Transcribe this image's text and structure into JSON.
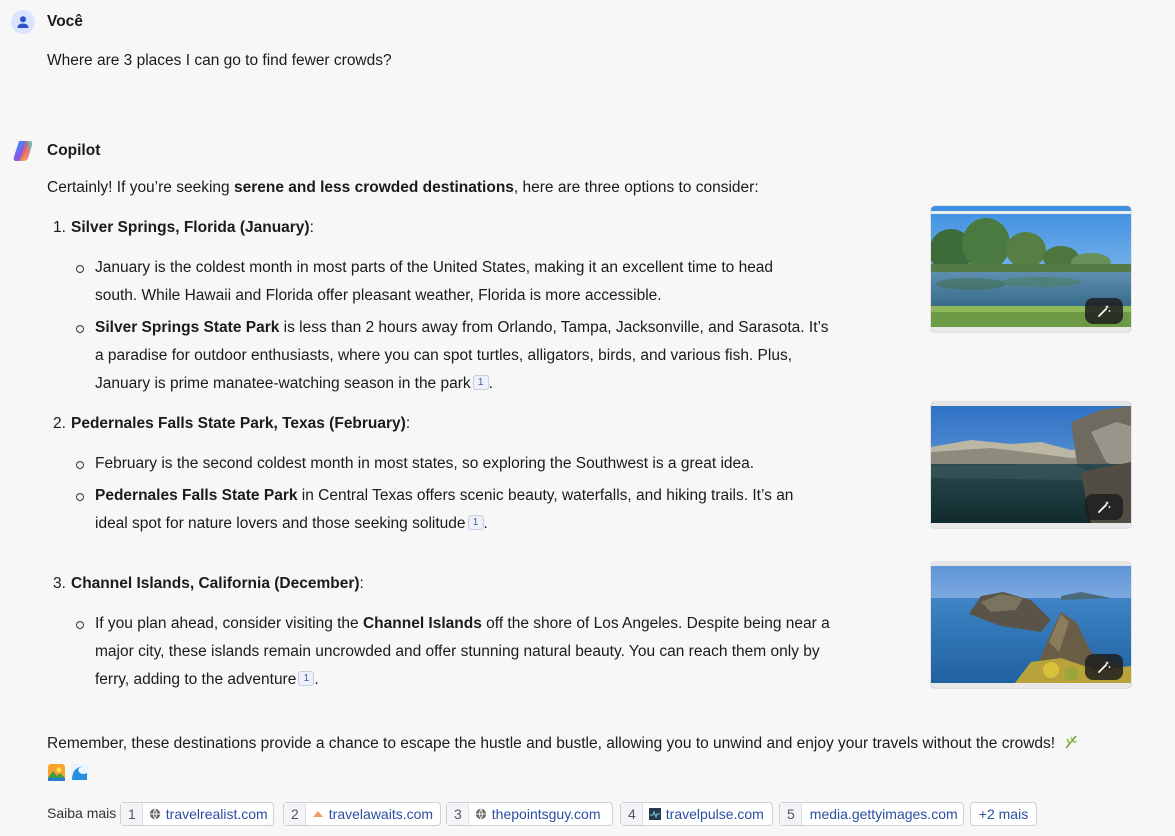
{
  "user": {
    "name": "Você",
    "message": "Where are 3 places I can go to find fewer crowds?"
  },
  "copilot": {
    "name": "Copilot",
    "intro_before": "Certainly! If you’re seeking ",
    "intro_bold": "serene and less crowded destinations",
    "intro_after": ", here are three options to consider:",
    "items": [
      {
        "number": "1.",
        "title": "Silver Springs, Florida (January)",
        "title_suffix": ":",
        "bullets": [
          {
            "pre": "January is the coldest month in most parts of the United States, making it an excellent time to head south. While Hawaii and Florida offer pleasant weather, Florida is more accessible."
          },
          {
            "bold": "Silver Springs State Park",
            "post": " is less than 2 hours away from Orlando, Tampa, Jacksonville, and Sarasota. It’s a paradise for outdoor enthusiasts, where you can spot turtles, alligators, birds, and various fish. Plus, January is prime manatee-watching season in the park",
            "cite": "1",
            "end": "."
          }
        ],
        "image_icon": "magic-wand-icon"
      },
      {
        "number": "2.",
        "title": "Pedernales Falls State Park, Texas (February)",
        "title_suffix": ":",
        "bullets": [
          {
            "pre": "February is the second coldest month in most states, so exploring the Southwest is a great idea."
          },
          {
            "bold": "Pedernales Falls State Park",
            "post": " in Central Texas offers scenic beauty, waterfalls, and hiking trails. It’s an ideal spot for nature lovers and those seeking solitude",
            "cite": "1",
            "end": "."
          }
        ],
        "image_icon": "magic-wand-icon"
      },
      {
        "number": "3.",
        "title": "Channel Islands, California (December)",
        "title_suffix": ":",
        "bullets": [
          {
            "pre": "If you plan ahead, consider visiting the ",
            "bold": "Channel Islands",
            "post": " off the shore of Los Angeles. Despite being near a major city, these islands remain uncrowded and offer stunning natural beauty. You can reach them only by ferry, adding to the adventure",
            "cite": "1",
            "end": "."
          }
        ],
        "image_icon": "magic-wand-icon"
      }
    ],
    "closing": "Remember, these destinations provide a chance to escape the hustle and bustle, allowing you to unwind and enjoy your travels without the crowds!",
    "emojis": [
      "herb-emoji",
      "sunrise-over-mountains-emoji",
      "water-wave-emoji"
    ]
  },
  "sources": {
    "label": "Saiba mais",
    "items": [
      {
        "n": "1",
        "site": "travelrealist.com",
        "icon": "globe-icon"
      },
      {
        "n": "2",
        "site": "travelawaits.com",
        "icon": "travelawaits-logo-icon"
      },
      {
        "n": "3",
        "site": "thepointsguy.com",
        "icon": "globe-icon"
      },
      {
        "n": "4",
        "site": "travelpulse.com",
        "icon": "travelpulse-logo-icon"
      },
      {
        "n": "5",
        "site": "media.gettyimages.com",
        "icon": ""
      }
    ],
    "more": "+2 mais"
  }
}
